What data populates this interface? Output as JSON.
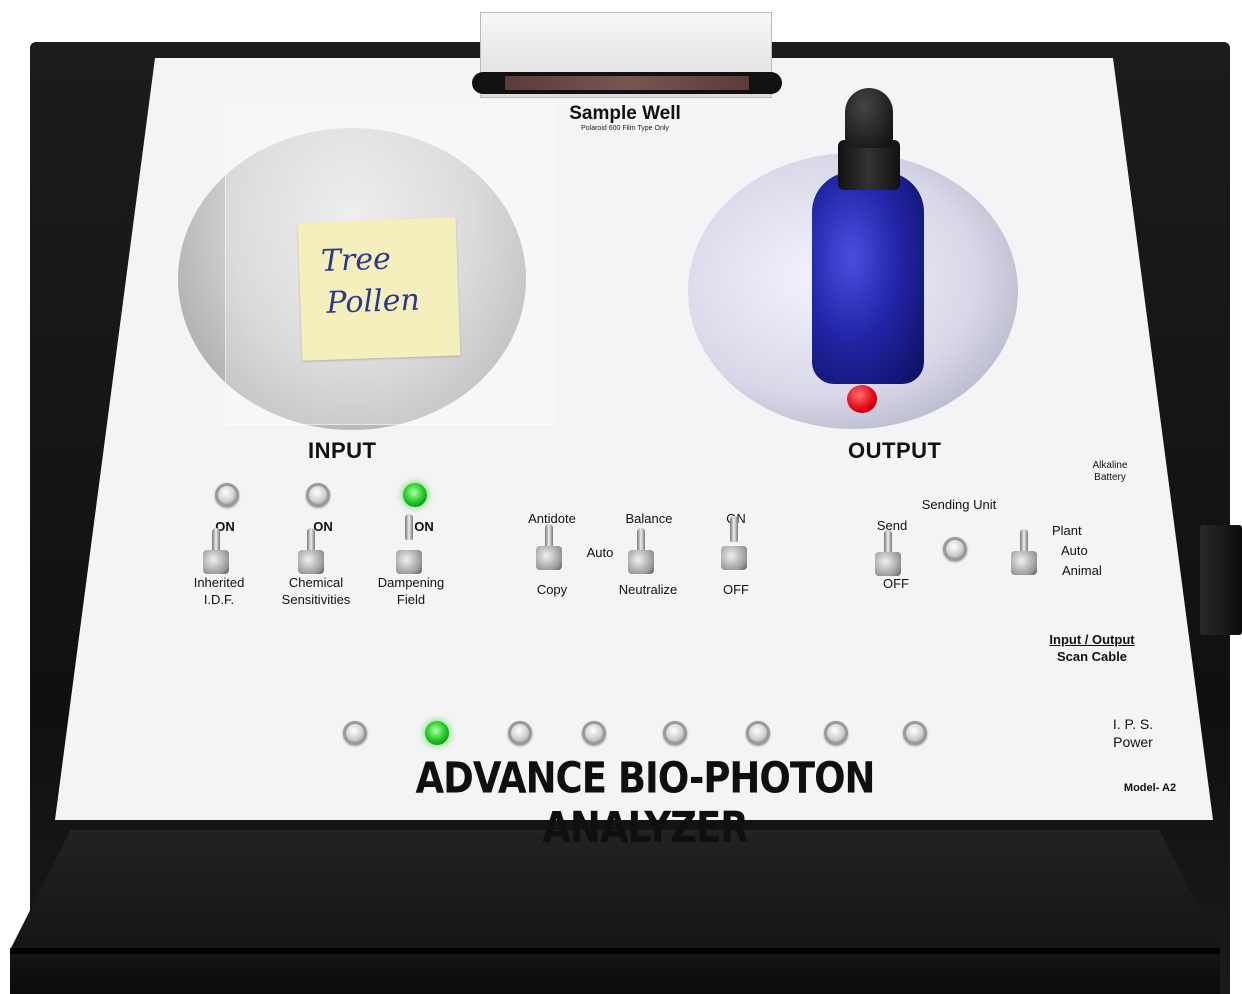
{
  "sample_well": {
    "title": "Sample Well",
    "subtitle": "Polaroid 600 Film Type Only"
  },
  "input": {
    "label": "INPUT",
    "note_line1": "Tree",
    "note_line2": "Pollen"
  },
  "output": {
    "label": "OUTPUT"
  },
  "input_switches": [
    {
      "on_label": "ON",
      "name_line1": "Inherited",
      "name_line2": "I.D.F.",
      "led": "off"
    },
    {
      "on_label": "ON",
      "name_line1": "Chemical",
      "name_line2": "Sensitivities",
      "led": "off"
    },
    {
      "on_label": "ON",
      "name_line1": "Dampening",
      "name_line2": "Field",
      "led": "on"
    }
  ],
  "mode_switches": {
    "antidote": "Antidote",
    "copy": "Copy",
    "auto": "Auto",
    "balance": "Balance",
    "neutralize": "Neutralize",
    "on": "ON",
    "off": "OFF"
  },
  "sending_unit": {
    "title": "Sending Unit",
    "send": "Send",
    "off": "OFF",
    "plant": "Plant",
    "auto": "Auto",
    "animal": "Animal"
  },
  "side_labels": {
    "battery_line1": "Alkaline",
    "battery_line2": "Battery",
    "cable_line1": "Input / Output",
    "cable_line2": "Scan Cable",
    "power_line1": "I. P. S.",
    "power_line2": "Power",
    "model": "Model- A2"
  },
  "bottom_leds": [
    "off",
    "on",
    "off",
    "off",
    "off",
    "off",
    "off",
    "off"
  ],
  "brand": "ADVANCE BIO-PHOTON ANALYZER",
  "colors": {
    "led_green": "#2ccf2c",
    "led_red": "#e00010",
    "plate": "#f4f4f6",
    "case": "#141414",
    "bottle": "#2226a8"
  }
}
